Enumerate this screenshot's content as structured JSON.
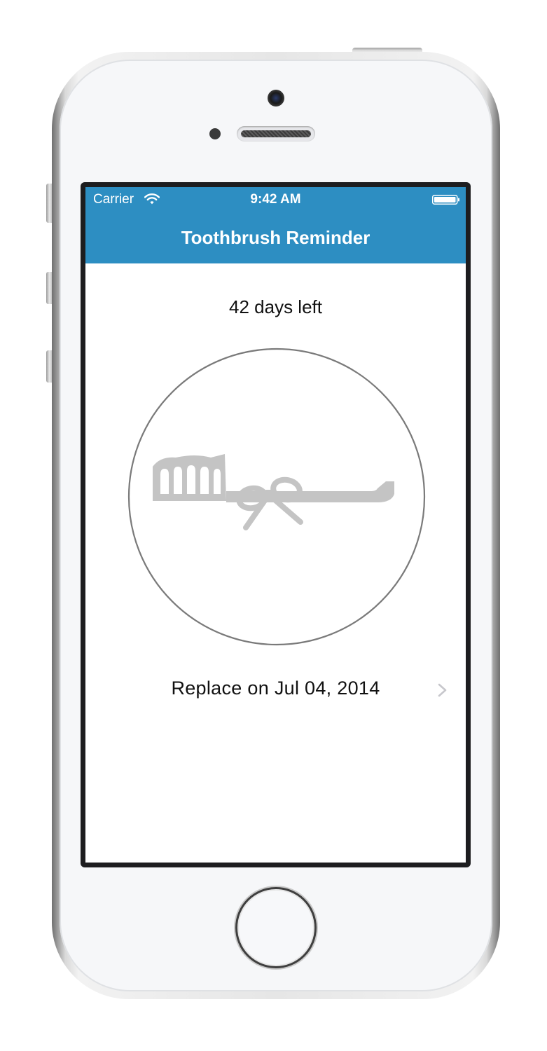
{
  "status_bar": {
    "carrier": "Carrier",
    "time": "9:42 AM",
    "icons": [
      "wifi-icon",
      "battery-icon"
    ]
  },
  "nav": {
    "title": "Toothbrush Reminder"
  },
  "main": {
    "days_left": "42 days left",
    "illustration": "toothbrush-with-bow-icon",
    "replace_label": "Replace on Jul 04, 2014",
    "chevron": "chevron-right-icon"
  },
  "colors": {
    "nav_background": "#2d8ec2",
    "illustration_gray": "#c4c4c4",
    "circle_stroke": "#7a7a7a",
    "chevron_gray": "#c7c7cc"
  }
}
